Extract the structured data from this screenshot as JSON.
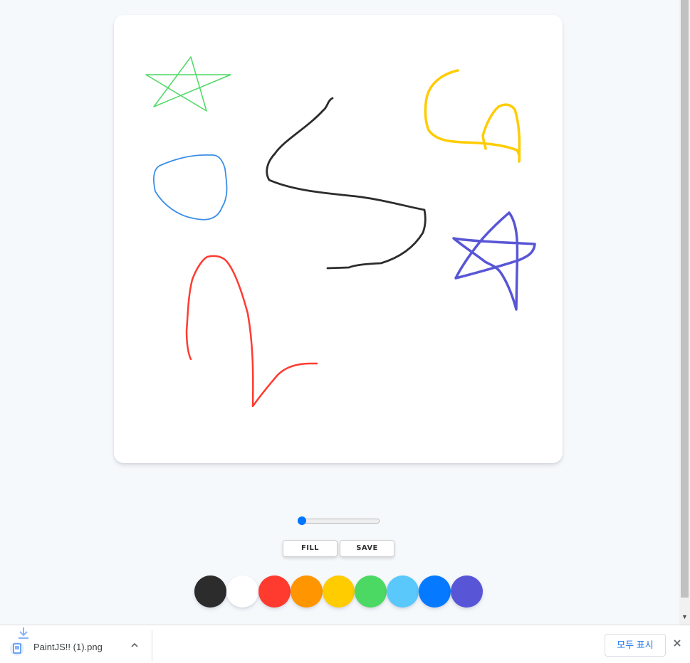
{
  "controls": {
    "range": {
      "min": 0.1,
      "max": 5,
      "value": 0.1
    },
    "fill_label": "FILL",
    "save_label": "SAVE"
  },
  "palette": [
    {
      "name": "black",
      "color": "#2c2c2c"
    },
    {
      "name": "white",
      "color": "#ffffff"
    },
    {
      "name": "red",
      "color": "#ff3b30"
    },
    {
      "name": "orange",
      "color": "#ff9500"
    },
    {
      "name": "yellow",
      "color": "#ffcc00"
    },
    {
      "name": "green",
      "color": "#4cd963"
    },
    {
      "name": "sky-blue",
      "color": "#5ac8fa"
    },
    {
      "name": "blue",
      "color": "#0579ff"
    },
    {
      "name": "purple",
      "color": "#5856d6"
    }
  ],
  "drawing": {
    "strokes": [
      {
        "name": "green-star-stroke",
        "color": "#4cd963"
      },
      {
        "name": "blue-circle-stroke",
        "color": "#3a8ee6"
      },
      {
        "name": "black-s-curve-stroke",
        "color": "#2c2c2c"
      },
      {
        "name": "yellow-curve-stroke",
        "color": "#ffcc00"
      },
      {
        "name": "purple-star-stroke",
        "color": "#5856d6"
      },
      {
        "name": "red-curve-stroke",
        "color": "#ff3b30"
      }
    ]
  },
  "download_shelf": {
    "file_name": "PaintJS!! (1).png",
    "show_all_label": "모두 표시"
  },
  "icons": {
    "file": "image-file-icon",
    "download": "download-arrow-icon",
    "menu": "chevron-up-icon",
    "close": "close-icon"
  }
}
